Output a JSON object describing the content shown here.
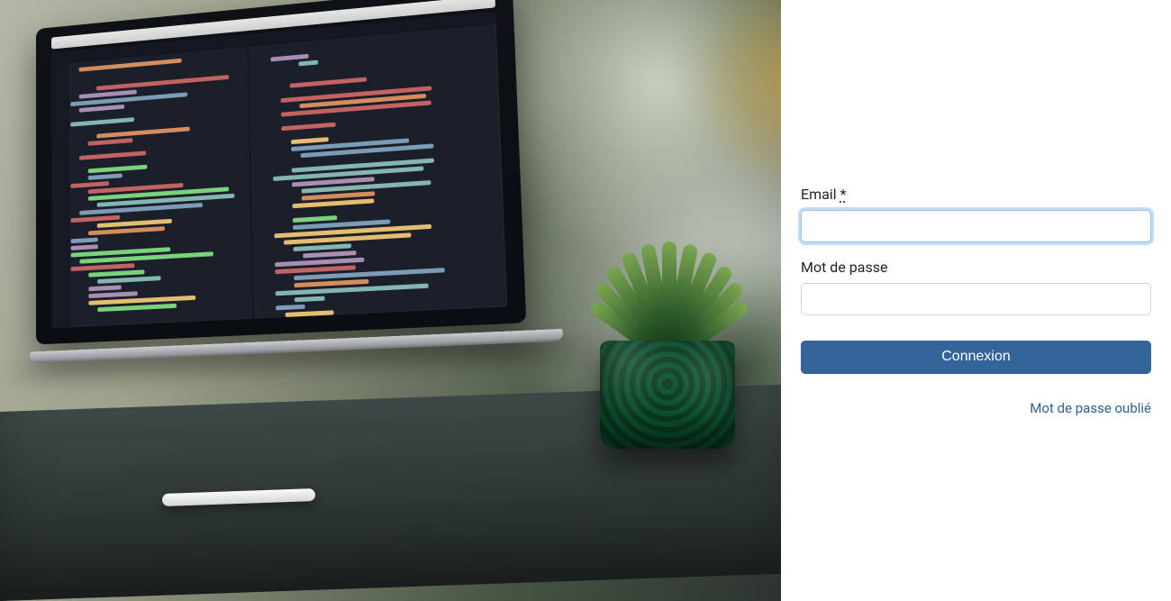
{
  "form": {
    "email_label": "Email",
    "required_marker": "*",
    "email_value": "",
    "password_label": "Mot de passe",
    "password_value": "",
    "submit_label": "Connexion",
    "forgot_link": "Mot de passe oublié"
  },
  "colors": {
    "primary_button": "#33649a",
    "link": "#2f5f97",
    "focus_ring": "rgba(13,110,253,0.25)"
  }
}
